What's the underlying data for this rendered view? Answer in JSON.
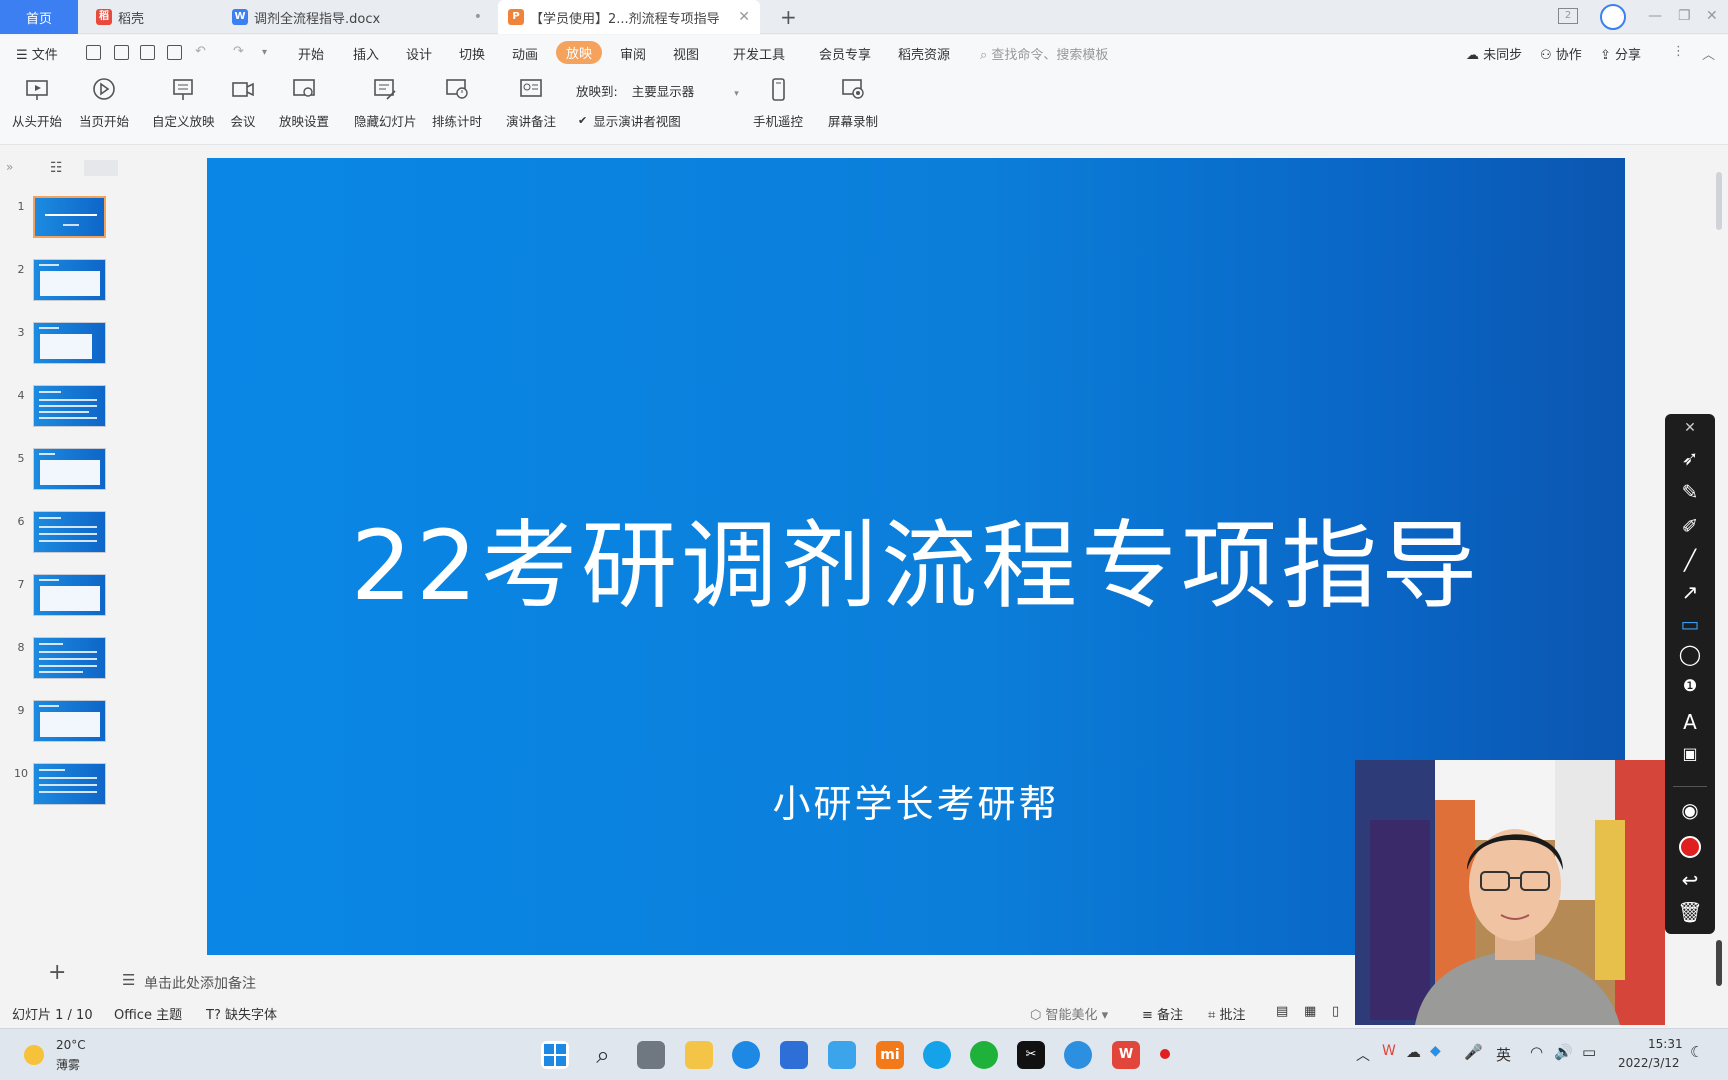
{
  "tabs": {
    "home": "首页",
    "daoke": "稻壳",
    "docx": "调剂全流程指导.docx",
    "ppt": "【学员使用】2...剂流程专项指导",
    "new_tab": "+"
  },
  "menu": {
    "file": "文件",
    "items": [
      "开始",
      "插入",
      "设计",
      "切换",
      "动画",
      "放映",
      "审阅",
      "视图",
      "开发工具",
      "会员专享",
      "稻壳资源"
    ],
    "search_placeholder": "查找命令、搜索模板",
    "sync": "未同步",
    "collab": "协作",
    "share": "分享"
  },
  "ribbon": {
    "from_start": "从头开始",
    "from_current": "当页开始",
    "custom": "自定义放映",
    "meeting": "会议",
    "settings": "放映设置",
    "hide_slide": "隐藏幻灯片",
    "rehearse": "排练计时",
    "notes": "演讲备注",
    "show_to_label": "放映到:",
    "show_to_value": "主要显示器",
    "presenter_view": "显示演讲者视图",
    "phone_remote": "手机遥控",
    "screen_record": "屏幕录制"
  },
  "thumbnails": [
    "1",
    "2",
    "3",
    "4",
    "5",
    "6",
    "7",
    "8",
    "9",
    "10"
  ],
  "slide": {
    "title": "22考研调剂流程专项指导",
    "subtitle": "小研学长考研帮"
  },
  "notes_placeholder": "单击此处添加备注",
  "status": {
    "slide_count": "幻灯片 1 / 10",
    "theme": "Office 主题",
    "missing_font": "缺失字体",
    "beautify": "智能美化",
    "notes": "备注",
    "comments": "批注"
  },
  "taskbar": {
    "temp": "20°C",
    "weather": "薄雾",
    "ime": "英",
    "time": "15:31",
    "date": "2022/3/12"
  },
  "colors": {
    "accent_tab": "#3c7ff2",
    "active_menu": "#f5a25d",
    "slide_blue": "#0a87e6",
    "record_red": "#e02020"
  }
}
